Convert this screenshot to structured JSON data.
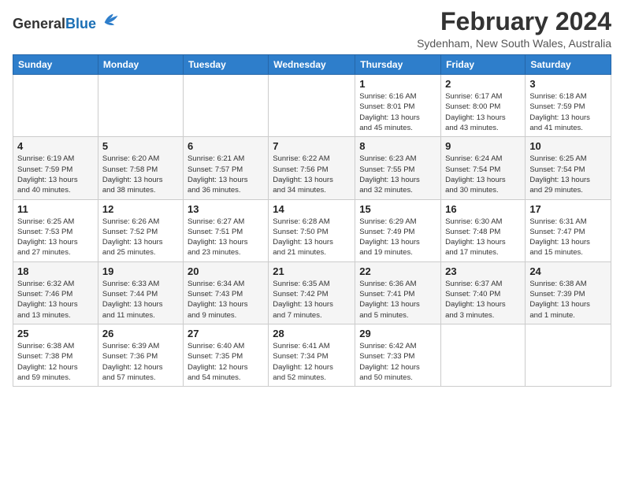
{
  "logo": {
    "general": "General",
    "blue": "Blue"
  },
  "header": {
    "title": "February 2024",
    "subtitle": "Sydenham, New South Wales, Australia"
  },
  "weekdays": [
    "Sunday",
    "Monday",
    "Tuesday",
    "Wednesday",
    "Thursday",
    "Friday",
    "Saturday"
  ],
  "weeks": [
    [
      {
        "day": "",
        "info": ""
      },
      {
        "day": "",
        "info": ""
      },
      {
        "day": "",
        "info": ""
      },
      {
        "day": "",
        "info": ""
      },
      {
        "day": "1",
        "info": "Sunrise: 6:16 AM\nSunset: 8:01 PM\nDaylight: 13 hours\nand 45 minutes."
      },
      {
        "day": "2",
        "info": "Sunrise: 6:17 AM\nSunset: 8:00 PM\nDaylight: 13 hours\nand 43 minutes."
      },
      {
        "day": "3",
        "info": "Sunrise: 6:18 AM\nSunset: 7:59 PM\nDaylight: 13 hours\nand 41 minutes."
      }
    ],
    [
      {
        "day": "4",
        "info": "Sunrise: 6:19 AM\nSunset: 7:59 PM\nDaylight: 13 hours\nand 40 minutes."
      },
      {
        "day": "5",
        "info": "Sunrise: 6:20 AM\nSunset: 7:58 PM\nDaylight: 13 hours\nand 38 minutes."
      },
      {
        "day": "6",
        "info": "Sunrise: 6:21 AM\nSunset: 7:57 PM\nDaylight: 13 hours\nand 36 minutes."
      },
      {
        "day": "7",
        "info": "Sunrise: 6:22 AM\nSunset: 7:56 PM\nDaylight: 13 hours\nand 34 minutes."
      },
      {
        "day": "8",
        "info": "Sunrise: 6:23 AM\nSunset: 7:55 PM\nDaylight: 13 hours\nand 32 minutes."
      },
      {
        "day": "9",
        "info": "Sunrise: 6:24 AM\nSunset: 7:54 PM\nDaylight: 13 hours\nand 30 minutes."
      },
      {
        "day": "10",
        "info": "Sunrise: 6:25 AM\nSunset: 7:54 PM\nDaylight: 13 hours\nand 29 minutes."
      }
    ],
    [
      {
        "day": "11",
        "info": "Sunrise: 6:25 AM\nSunset: 7:53 PM\nDaylight: 13 hours\nand 27 minutes."
      },
      {
        "day": "12",
        "info": "Sunrise: 6:26 AM\nSunset: 7:52 PM\nDaylight: 13 hours\nand 25 minutes."
      },
      {
        "day": "13",
        "info": "Sunrise: 6:27 AM\nSunset: 7:51 PM\nDaylight: 13 hours\nand 23 minutes."
      },
      {
        "day": "14",
        "info": "Sunrise: 6:28 AM\nSunset: 7:50 PM\nDaylight: 13 hours\nand 21 minutes."
      },
      {
        "day": "15",
        "info": "Sunrise: 6:29 AM\nSunset: 7:49 PM\nDaylight: 13 hours\nand 19 minutes."
      },
      {
        "day": "16",
        "info": "Sunrise: 6:30 AM\nSunset: 7:48 PM\nDaylight: 13 hours\nand 17 minutes."
      },
      {
        "day": "17",
        "info": "Sunrise: 6:31 AM\nSunset: 7:47 PM\nDaylight: 13 hours\nand 15 minutes."
      }
    ],
    [
      {
        "day": "18",
        "info": "Sunrise: 6:32 AM\nSunset: 7:46 PM\nDaylight: 13 hours\nand 13 minutes."
      },
      {
        "day": "19",
        "info": "Sunrise: 6:33 AM\nSunset: 7:44 PM\nDaylight: 13 hours\nand 11 minutes."
      },
      {
        "day": "20",
        "info": "Sunrise: 6:34 AM\nSunset: 7:43 PM\nDaylight: 13 hours\nand 9 minutes."
      },
      {
        "day": "21",
        "info": "Sunrise: 6:35 AM\nSunset: 7:42 PM\nDaylight: 13 hours\nand 7 minutes."
      },
      {
        "day": "22",
        "info": "Sunrise: 6:36 AM\nSunset: 7:41 PM\nDaylight: 13 hours\nand 5 minutes."
      },
      {
        "day": "23",
        "info": "Sunrise: 6:37 AM\nSunset: 7:40 PM\nDaylight: 13 hours\nand 3 minutes."
      },
      {
        "day": "24",
        "info": "Sunrise: 6:38 AM\nSunset: 7:39 PM\nDaylight: 13 hours\nand 1 minute."
      }
    ],
    [
      {
        "day": "25",
        "info": "Sunrise: 6:38 AM\nSunset: 7:38 PM\nDaylight: 12 hours\nand 59 minutes."
      },
      {
        "day": "26",
        "info": "Sunrise: 6:39 AM\nSunset: 7:36 PM\nDaylight: 12 hours\nand 57 minutes."
      },
      {
        "day": "27",
        "info": "Sunrise: 6:40 AM\nSunset: 7:35 PM\nDaylight: 12 hours\nand 54 minutes."
      },
      {
        "day": "28",
        "info": "Sunrise: 6:41 AM\nSunset: 7:34 PM\nDaylight: 12 hours\nand 52 minutes."
      },
      {
        "day": "29",
        "info": "Sunrise: 6:42 AM\nSunset: 7:33 PM\nDaylight: 12 hours\nand 50 minutes."
      },
      {
        "day": "",
        "info": ""
      },
      {
        "day": "",
        "info": ""
      }
    ]
  ]
}
